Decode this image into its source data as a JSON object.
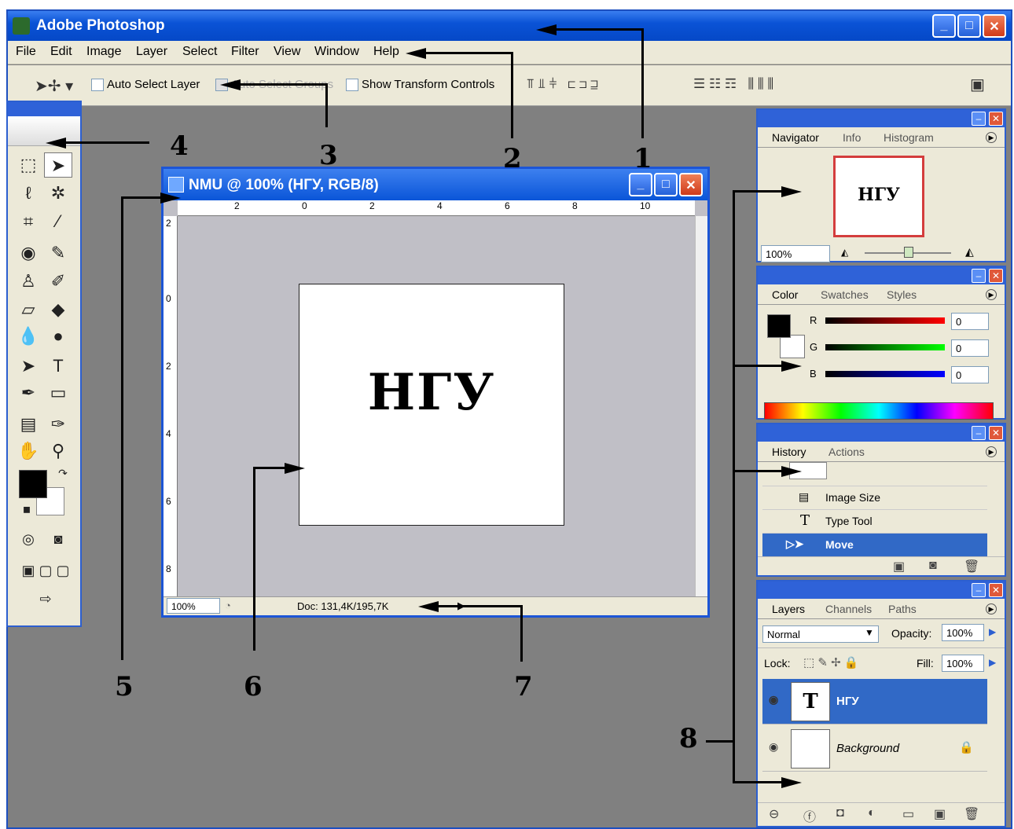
{
  "window": {
    "title": "Adobe Photoshop",
    "min": "_",
    "max": "□",
    "close": "✕"
  },
  "menu": [
    "File",
    "Edit",
    "Image",
    "Layer",
    "Select",
    "Filter",
    "View",
    "Window",
    "Help"
  ],
  "options": {
    "auto_select": "Auto Select Layer",
    "auto_groups": "Auto Select Groups",
    "show_transform": "Show Transform Controls"
  },
  "document": {
    "title": "NMU @ 100% (НГУ, RGB/8)",
    "canvas_text": "НГУ",
    "zoom": "100%",
    "doc_info": "Doc: 131,4K/195,7K",
    "ruler_h": [
      "2",
      "0",
      "2",
      "4",
      "6",
      "8",
      "10"
    ],
    "ruler_v": [
      "2",
      "0",
      "2",
      "4",
      "6",
      "8"
    ]
  },
  "navigator": {
    "tabs": [
      "Navigator",
      "Info",
      "Histogram"
    ],
    "thumb_text": "НГУ",
    "zoom": "100%"
  },
  "color": {
    "tabs": [
      "Color",
      "Swatches",
      "Styles"
    ],
    "channels": [
      {
        "name": "R",
        "value": "0"
      },
      {
        "name": "G",
        "value": "0"
      },
      {
        "name": "B",
        "value": "0"
      }
    ]
  },
  "history": {
    "tabs": [
      "History",
      "Actions"
    ],
    "items": [
      "Image Size",
      "Type Tool",
      "Move"
    ]
  },
  "layers": {
    "tabs": [
      "Layers",
      "Channels",
      "Paths"
    ],
    "blend": "Normal",
    "opacity_label": "Opacity:",
    "opacity": "100%",
    "lock_label": "Lock:",
    "fill_label": "Fill:",
    "fill": "100%",
    "items": [
      {
        "name": "НГУ",
        "thumb": "T"
      },
      {
        "name": "Background",
        "thumb": ""
      }
    ]
  },
  "annotations": [
    "1",
    "2",
    "3",
    "4",
    "5",
    "6",
    "7",
    "8"
  ],
  "colors": {
    "title_blue": "#0a53d6",
    "panel": "#ece9d8",
    "workspace": "#808080",
    "selection": "#3169c6"
  }
}
